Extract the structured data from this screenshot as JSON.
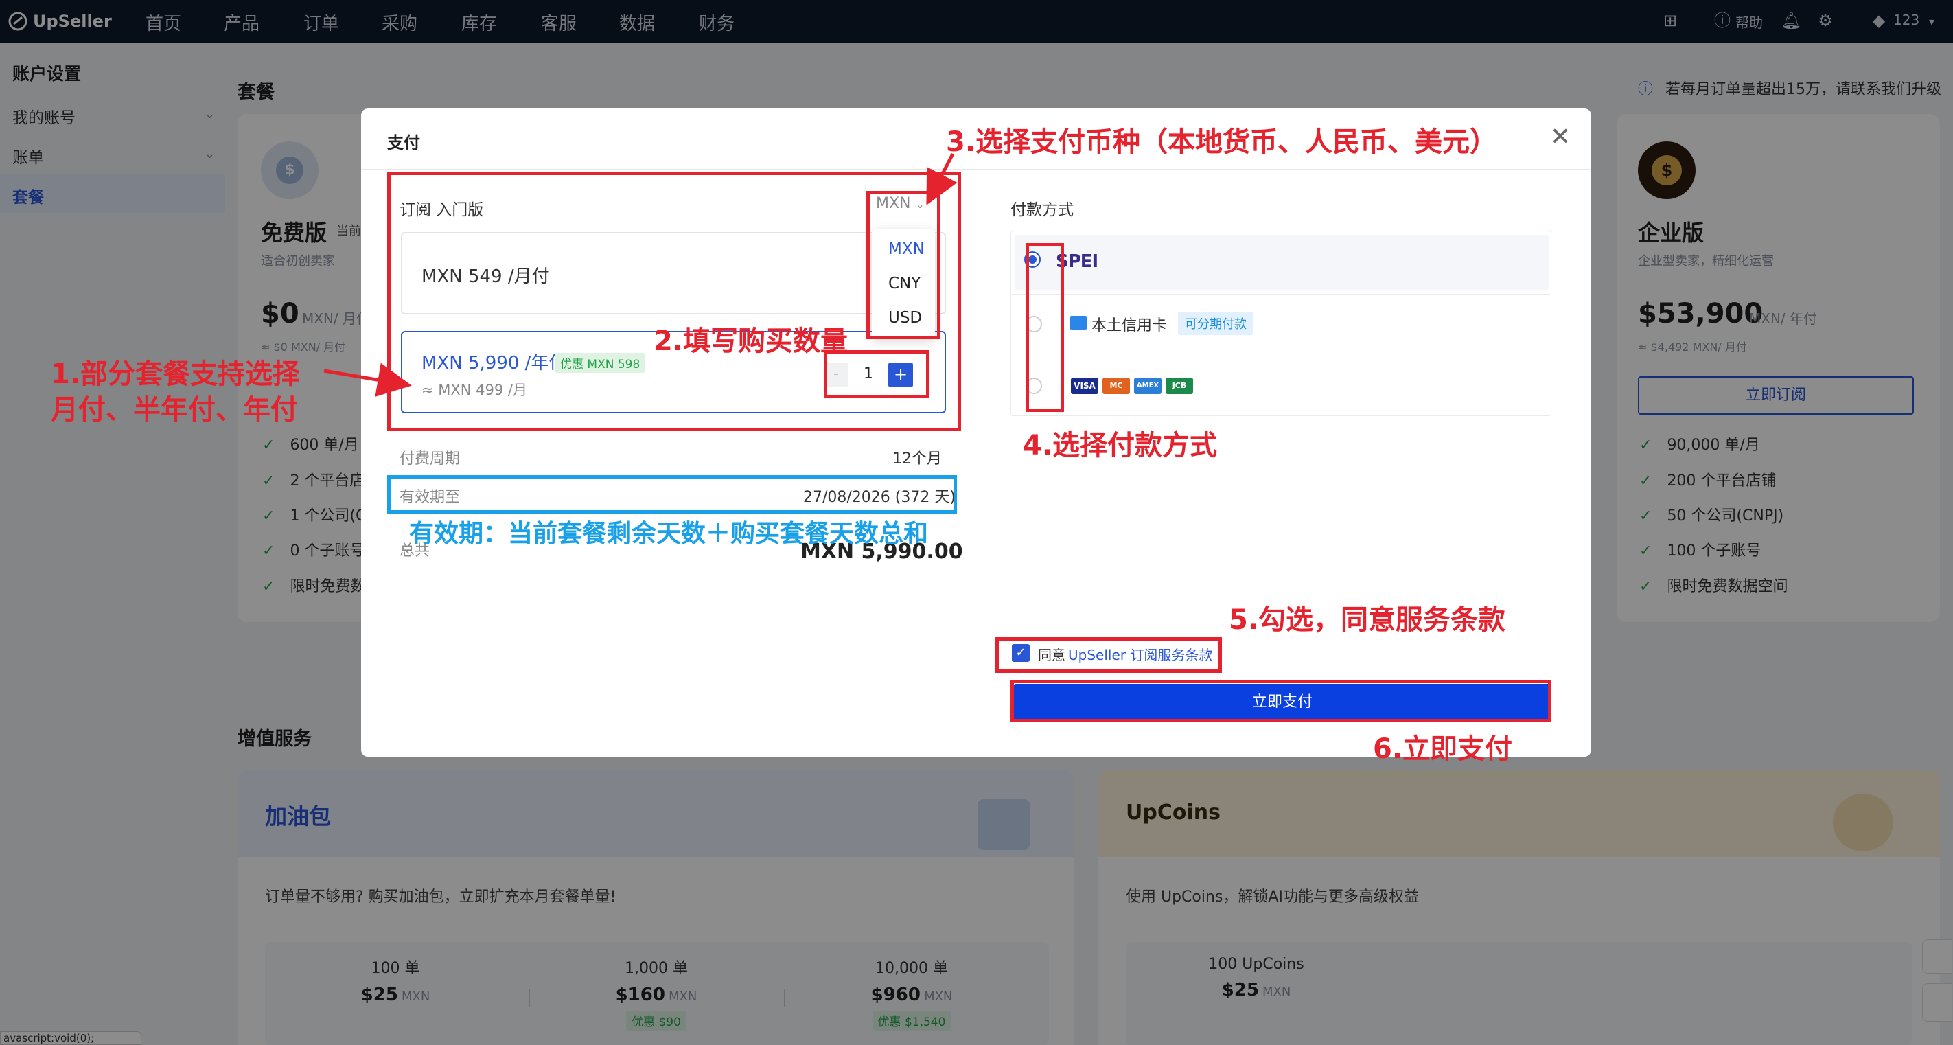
{
  "nav": {
    "brand": "UpSeller",
    "items": [
      "首页",
      "产品",
      "订单",
      "采购",
      "库存",
      "客服",
      "数据",
      "财务"
    ],
    "help": "帮助",
    "points": "123"
  },
  "sidebar": {
    "title": "账户设置",
    "items": [
      {
        "label": "我的账号"
      },
      {
        "label": "账单"
      },
      {
        "label": "套餐"
      }
    ]
  },
  "page": {
    "plans_title": "套餐",
    "notice": "若每月订单量超出15万，请联系我们升级",
    "free_plan": {
      "name": "免费版",
      "badge": "当前",
      "desc": "适合初创卖家",
      "price": "$0",
      "unit": "MXN/ 月付",
      "approx": "≈ $0 MXN/ 月付",
      "features": [
        "600 单/月",
        "2 个平台店",
        "1 个公司(C",
        "0 个子账号",
        "限时免费数"
      ]
    },
    "enterprise_plan": {
      "name": "企业版",
      "desc": "企业型卖家，精细化运营",
      "price": "$53,900",
      "unit": "MXN/ 年付",
      "approx": "≈ $4,492 MXN/ 月付",
      "button": "立即订阅",
      "features": [
        "90,000 单/月",
        "200 个平台店铺",
        "50 个公司(CNPJ)",
        "100 个子账号",
        "限时免费数据空间"
      ]
    },
    "value_added_title": "增值服务",
    "fuel_pack": {
      "title": "加油包",
      "desc": "订单量不够用? 购买加油包，立即扩充本月套餐单量!",
      "options": [
        {
          "qty": "100 单",
          "price": "$25",
          "cur": "MXN",
          "discount": ""
        },
        {
          "qty": "1,000 单",
          "price": "$160",
          "cur": "MXN",
          "discount": "优惠 $90"
        },
        {
          "qty": "10,000 单",
          "price": "$960",
          "cur": "MXN",
          "discount": "优惠 $1,540"
        }
      ]
    },
    "upcoins": {
      "title": "UpCoins",
      "desc": "使用 UpCoins，解锁AI功能与更多高级权益",
      "option": {
        "qty": "100 UpCoins",
        "price": "$25",
        "cur": "MXN"
      }
    },
    "status_bar": "avascript:void(0);"
  },
  "modal": {
    "title": "支付",
    "subscribe_label": "订阅 入门版",
    "currency_selected": "MXN",
    "currency_options": [
      "MXN",
      "CNY",
      "USD"
    ],
    "monthly_option": "MXN 549 /月付",
    "yearly_option": "MXN 5,990 /年付",
    "yearly_discount": "优惠 MXN 598",
    "yearly_approx": "≈ MXN 499 /月",
    "quantity": "1",
    "period_label": "付费周期",
    "period_value": "12个月",
    "valid_label": "有效期至",
    "valid_value": "27/08/2026 (372 天)",
    "total_label": "总共",
    "total_value": "MXN 5,990.00",
    "payment_label": "付款方式",
    "spei": "SPEI",
    "local_card": "本土信用卡",
    "installment_badge": "可分期付款",
    "agree_prefix": "同意",
    "agree_link": "UpSeller 订阅服务条款",
    "pay_button": "立即支付",
    "card_brands": [
      "VISA",
      "MC",
      "AMEX",
      "JCB"
    ]
  },
  "annotations": {
    "a1_line1": "1.部分套餐支持选择",
    "a1_line2": "月付、半年付、年付",
    "a2": "2.填写购买数量",
    "a3": "3.选择支付币种（本地货币、人民币、美元）",
    "a4": "4.选择付款方式",
    "a5": "5.勾选，同意服务条款",
    "a6": "6.立即支付",
    "valid_note": "有效期：当前套餐剩余天数＋购买套餐天数总和"
  },
  "colors": {
    "accent": "#2a57d6",
    "pay_button": "#0a3fe0",
    "annotation_red": "#e5232e",
    "annotation_blue": "#18a0e8",
    "nav_bg": "#0e1a2b"
  }
}
